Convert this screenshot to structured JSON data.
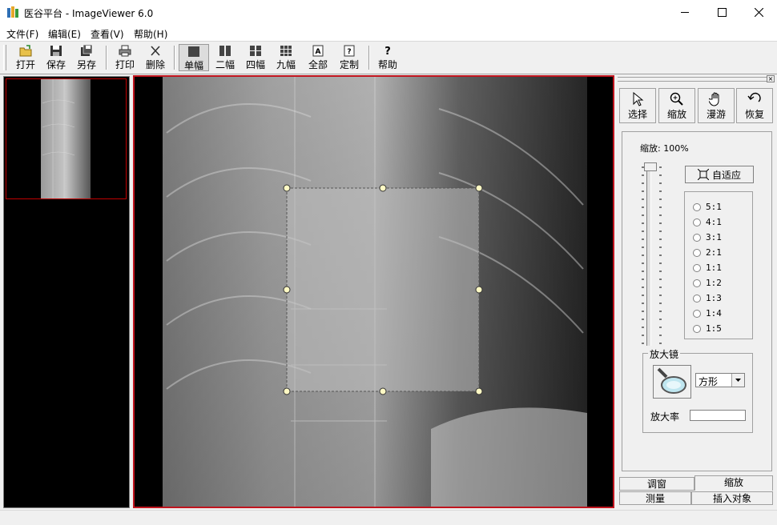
{
  "window": {
    "title": "医谷平台 - ImageViewer 6.0",
    "minimize": "—",
    "maximize": "☐",
    "close": "✕"
  },
  "menu": [
    {
      "label": "文件(F)"
    },
    {
      "label": "编辑(E)"
    },
    {
      "label": "查看(V)"
    },
    {
      "label": "帮助(H)"
    }
  ],
  "toolbar": {
    "open": "打开",
    "save": "保存",
    "save_as": "另存",
    "print": "打印",
    "delete": "删除",
    "single": "单幅",
    "two": "二幅",
    "four": "四幅",
    "nine": "九幅",
    "all": "全部",
    "custom": "定制",
    "help": "帮助"
  },
  "tools": {
    "select": "选择",
    "zoom": "缩放",
    "pan": "漫游",
    "restore": "恢复"
  },
  "zoom_panel": {
    "zoom_label": "缩放: 100%",
    "zoom_percent": 100,
    "fit_button": "自适应",
    "ratios": [
      "5:1",
      "4:1",
      "3:1",
      "2:1",
      "1:1",
      "1:2",
      "1:3",
      "1:4",
      "1:5"
    ]
  },
  "magnifier": {
    "group_label": "放大镜",
    "shape_value": "方形",
    "rate_label": "放大率",
    "rate_value": ""
  },
  "tabs": {
    "window_level": "调窗",
    "zoom": "缩放",
    "measure": "测量",
    "insert": "插入对象"
  },
  "colors": {
    "accent_border": "#c0141e",
    "handle_fill": "#fff9c4"
  }
}
